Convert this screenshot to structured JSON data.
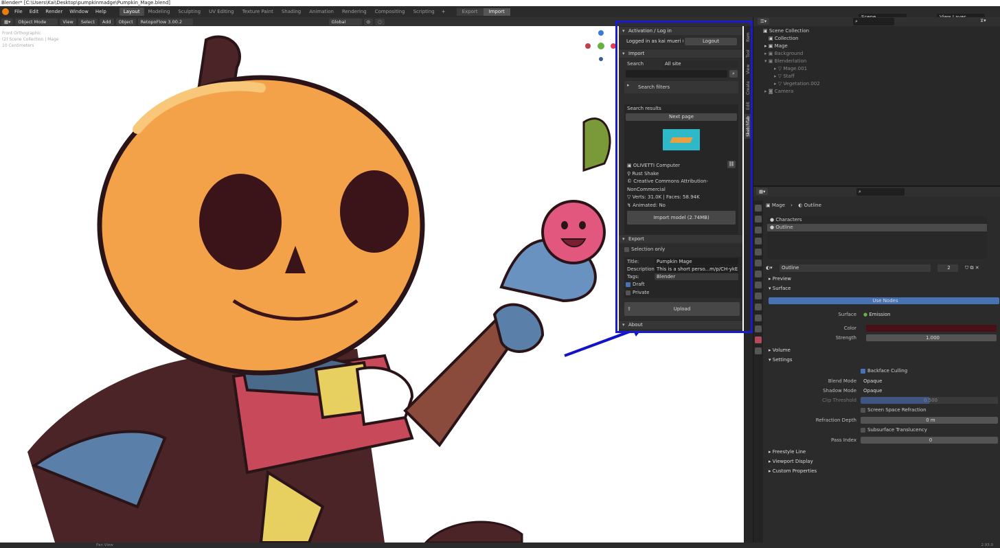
{
  "window": {
    "title": "Blender* [C:\\Users\\Kai\\Desktop\\pumpkinmadge\\Pumpkin_Mage.blend]"
  },
  "menu": [
    "File",
    "Edit",
    "Render",
    "Window",
    "Help"
  ],
  "workspaces": [
    "Layout",
    "Modeling",
    "Sculpting",
    "UV Editing",
    "Texture Paint",
    "Shading",
    "Animation",
    "Rendering",
    "Compositing",
    "Scripting",
    "+"
  ],
  "export_import": {
    "export": "Export",
    "import": "Import"
  },
  "scene": {
    "scene": "Scene",
    "view_layer": "View Layer"
  },
  "viewport_header": {
    "mode": "Object Mode",
    "view": "View",
    "select": "Select",
    "add": "Add",
    "object": "Object",
    "addon": "RetopoFlow 3.00.2",
    "orientation": "Global"
  },
  "viewport_info": [
    "Front Orthographic",
    "(2) Scene Collection | Mage",
    "10 Centimeters"
  ],
  "side_tabs": [
    "Item",
    "Tool",
    "View",
    "Create",
    "Edit",
    "Sketchfab"
  ],
  "sketchfab": {
    "activation_title": "Activation / Log in",
    "logged_in": "Logged in as kai mueri (ba...",
    "logout": "Logout",
    "import_title": "Import",
    "search_label": "Search",
    "search_scope": "All site",
    "search_filters": "Search filters",
    "search_results": "Search results",
    "next_page": "Next page",
    "model": {
      "name": "OLIVETTI Computer",
      "author": "Rust Shake",
      "license": "Creative Commons Attribution-NonCommercial",
      "stats": "Verts: 31.0K  |  Faces: 58.94K",
      "animated": "Animated: No"
    },
    "import_button": "Import model (2.74MB)",
    "export_title": "Export",
    "selection_only": "Selection only",
    "title_label": "Title:",
    "title_value": "Pumpkin Mage",
    "desc_label": "Description:",
    "desc_value": "This is a short perso...m/p/CH-ykE2JoGP/).",
    "tags_label": "Tags:",
    "tags_value": "Blender",
    "draft": "Draft",
    "private": "Private",
    "upload": "Upload",
    "about": "About"
  },
  "outliner": [
    {
      "label": "Scene Collection",
      "indent": 0
    },
    {
      "label": "Collection",
      "indent": 1
    },
    {
      "label": "Mage",
      "indent": 1
    },
    {
      "label": "Background",
      "indent": 1
    },
    {
      "label": "Blenderlation",
      "indent": 1
    },
    {
      "label": "Mage.001",
      "indent": 2
    },
    {
      "label": "Staff",
      "indent": 2
    },
    {
      "label": "Vegetation.002",
      "indent": 2
    },
    {
      "label": "Camera",
      "indent": 1
    }
  ],
  "properties": {
    "breadcrumb_object": "Mage",
    "breadcrumb_material": "Outline",
    "slots": [
      "Characters",
      "Outline"
    ],
    "material_name": "Outline",
    "users": "2",
    "preview": "Preview",
    "surface": "Surface",
    "use_nodes": "Use Nodes",
    "surface_label": "Surface",
    "surface_value": "Emission",
    "color_label": "Color",
    "strength_label": "Strength",
    "strength_value": "1.000",
    "volume": "Volume",
    "settings": "Settings",
    "backface": "Backface Culling",
    "blend_label": "Blend Mode",
    "blend_value": "Opaque",
    "shadow_label": "Shadow Mode",
    "shadow_value": "Opaque",
    "clip_label": "Clip Threshold",
    "clip_value": "0.500",
    "ssr": "Screen Space Refraction",
    "refr_label": "Refraction Depth",
    "refr_value": "0 m",
    "sst": "Subsurface Translucency",
    "pass_label": "Pass Index",
    "pass_value": "0",
    "freestyle": "Freestyle Line",
    "viewport_display": "Viewport Display",
    "custom_props": "Custom Properties"
  },
  "status": {
    "left": "Pan View",
    "right": "2.93.0"
  },
  "colors": {
    "accent": "#4772b3",
    "annotation": "#1a1ad0",
    "material_color": "#4a1018"
  }
}
